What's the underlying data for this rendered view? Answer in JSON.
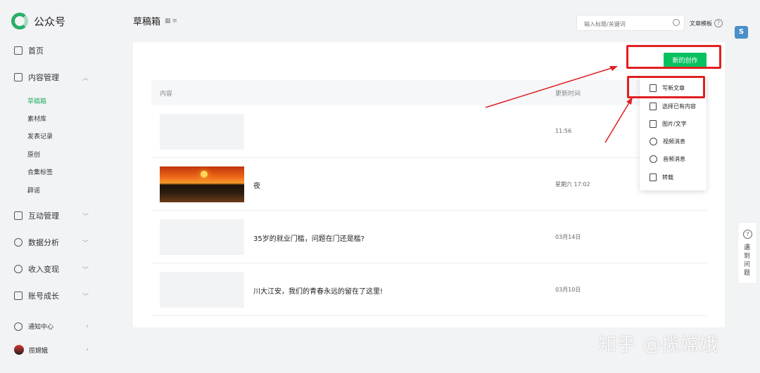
{
  "app": {
    "name": "公众号"
  },
  "sidebar": {
    "home": "首页",
    "content_mgmt": "内容管理",
    "sub_items": [
      "草稿箱",
      "素材库",
      "发表记录",
      "原创",
      "合集标签",
      "辟谣"
    ],
    "interaction": "互动管理",
    "data_analysis": "数据分析",
    "income": "收入变现",
    "growth": "账号成长",
    "notifications": "通知中心",
    "account_name": "揽嫦娥"
  },
  "header": {
    "title": "草稿箱",
    "search_placeholder": "输入标题/关键词",
    "template_link": "文章模板"
  },
  "main": {
    "new_button": "新的创作",
    "col_content": "内容",
    "col_time": "更新时间",
    "rows": [
      {
        "title": "",
        "time": "11:56"
      },
      {
        "title": "夜",
        "time": "星期六 17:02"
      },
      {
        "title": "35岁的就业门槛，问题在门还是槛?",
        "time": "03月14日"
      },
      {
        "title": "川大江安，我们的青春永远的留在了这里!",
        "time": "03月10日"
      }
    ]
  },
  "dropdown": {
    "items": [
      "写新文章",
      "选择已有内容",
      "图片/文字",
      "视频消息",
      "音频消息",
      "转载"
    ]
  },
  "help": {
    "label": "遇到问题"
  },
  "watermark": "知乎 @揽嫦娥",
  "colors": {
    "accent": "#07c160",
    "annotation": "#e02020"
  }
}
